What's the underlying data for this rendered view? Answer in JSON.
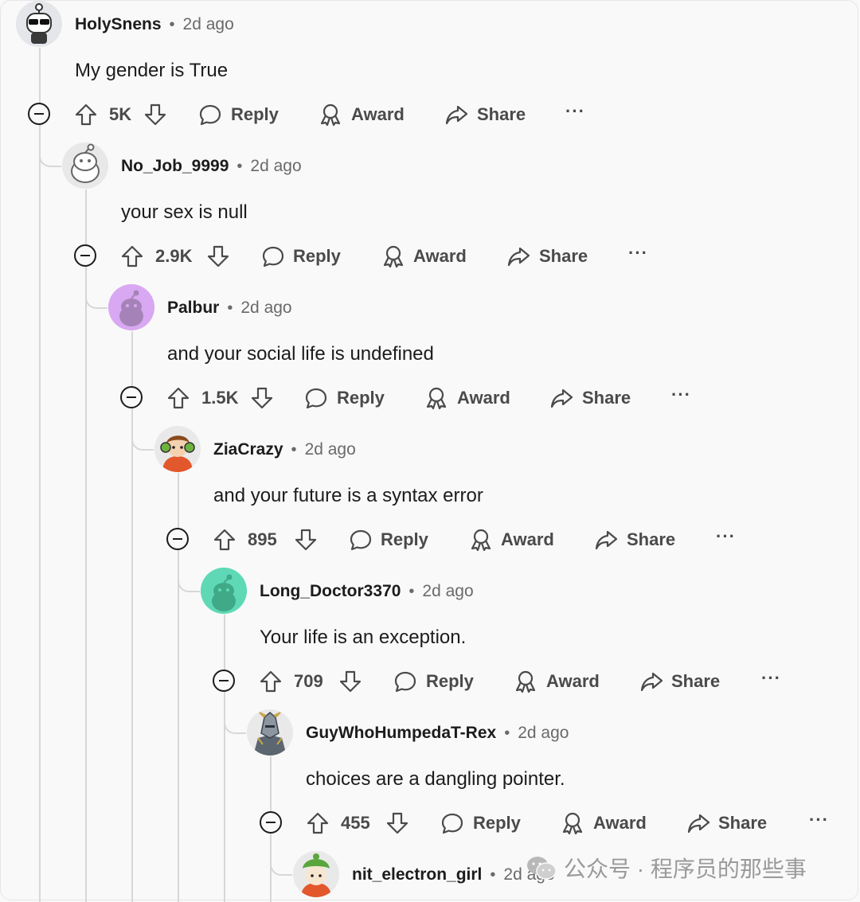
{
  "comments": [
    {
      "username": "HolySnens",
      "time": "2d ago",
      "text": "My gender is True",
      "votes": "5K",
      "avatar": "robot-sunglasses"
    },
    {
      "username": "No_Job_9999",
      "time": "2d ago",
      "text": "your sex is null",
      "votes": "2.9K",
      "avatar": "snoo-white"
    },
    {
      "username": "Palbur",
      "time": "2d ago",
      "text": "and your social life is undefined",
      "votes": "1.5K",
      "avatar": "snoo-purple"
    },
    {
      "username": "ZiaCrazy",
      "time": "2d ago",
      "text": "and your future is a syntax error",
      "votes": "895",
      "avatar": "cartoon-headphones"
    },
    {
      "username": "Long_Doctor3370",
      "time": "2d ago",
      "text": "Your life is an exception.",
      "votes": "709",
      "avatar": "snoo-teal"
    },
    {
      "username": "GuyWhoHumpedaT-Rex",
      "time": "2d ago",
      "text": "choices are a dangling pointer.",
      "votes": "455",
      "avatar": "armored-knight"
    },
    {
      "username": "nit_electron_girl",
      "time": "2d ago",
      "avatar": "cartoon-green-hat"
    }
  ],
  "actions": {
    "reply": "Reply",
    "award": "Award",
    "share": "Share",
    "more": "···"
  },
  "separator": "•",
  "watermark": "公众号 · 程序员的那些事",
  "colors": {
    "background": "#f9f9f9",
    "text": "#1c1c1c",
    "muted": "#6a6a6a",
    "thread_line": "#d7d7d7",
    "avatar_purple": "#d9a8f2",
    "avatar_teal": "#5fd9b5"
  }
}
